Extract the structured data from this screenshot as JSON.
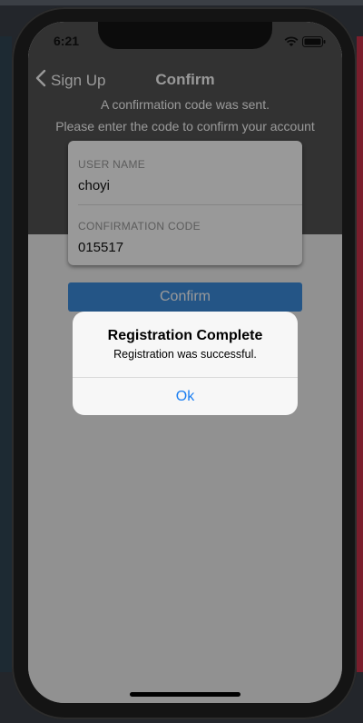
{
  "status_bar": {
    "time": "6:21"
  },
  "navbar": {
    "back_label": "Sign Up",
    "title": "Confirm"
  },
  "info": {
    "line1": "A confirmation code was sent.",
    "line2": "Please enter the code to confirm your account"
  },
  "form": {
    "username_label": "USER NAME",
    "username_value": "choyi",
    "code_label": "CONFIRMATION CODE",
    "code_value": "015517"
  },
  "confirm_button": {
    "label": "Confirm"
  },
  "alert": {
    "title": "Registration Complete",
    "message": "Registration was successful.",
    "ok_label": "Ok"
  },
  "colors": {
    "accent": "#3d8ee0",
    "link": "#1a7ef2",
    "header_bg": "#545454"
  },
  "icons": [
    "chevron-left-icon",
    "wifi-icon",
    "battery-icon"
  ]
}
